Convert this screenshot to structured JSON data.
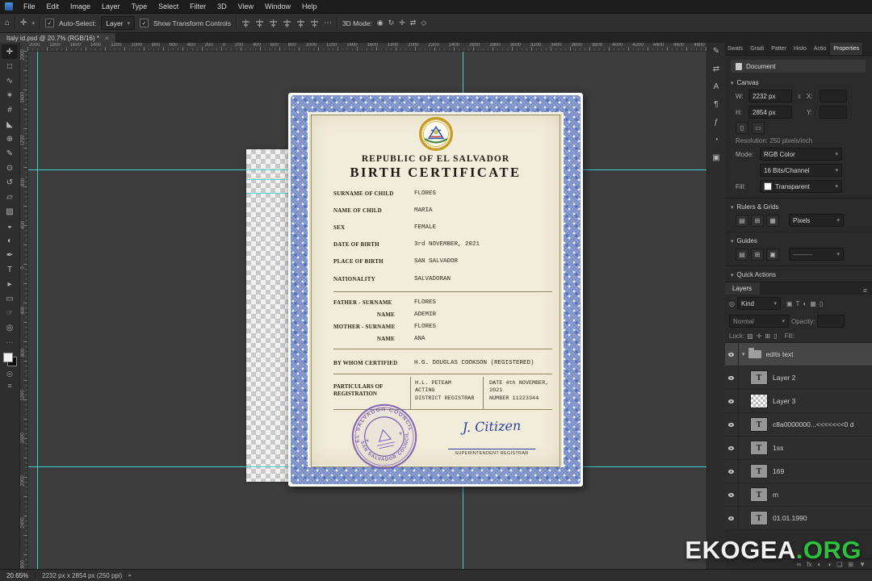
{
  "menu": {
    "items": [
      "File",
      "Edit",
      "Image",
      "Layer",
      "Type",
      "Select",
      "Filter",
      "3D",
      "View",
      "Window",
      "Help"
    ]
  },
  "icons": {
    "home": "⌂",
    "move_tool": "✛",
    "dropdown": "▾",
    "check": "✓",
    "ellipsis": "⋯",
    "menu": "≡",
    "tab_close": "×",
    "star": "✶",
    "link": "∞",
    "search": "◎",
    "scroll_arrow": "▸"
  },
  "options_bar": {
    "auto_select_label": "Auto-Select:",
    "auto_select_value": "Layer",
    "show_transform_label": "Show Transform Controls",
    "mode_3d_label": "3D Mode:",
    "mode_3d_icons": [
      {
        "name": "3d-orbit-icon",
        "glyph": "◉"
      },
      {
        "name": "3d-roll-icon",
        "glyph": "↻"
      },
      {
        "name": "3d-pan-icon",
        "glyph": "✛"
      },
      {
        "name": "3d-slide-icon",
        "glyph": "⇄"
      },
      {
        "name": "3d-scale-icon",
        "glyph": "◇"
      }
    ]
  },
  "document_tab": {
    "title": "Italy id.psd @ 20.7% (RGB/16) *"
  },
  "tools": [
    {
      "name": "move-tool",
      "glyph": "✛"
    },
    {
      "name": "marquee-tool",
      "glyph": "□"
    },
    {
      "name": "lasso-tool",
      "glyph": "∿"
    },
    {
      "name": "magic-wand-tool",
      "glyph": "✶"
    },
    {
      "name": "crop-tool",
      "glyph": "#"
    },
    {
      "name": "eyedropper-tool",
      "glyph": "◣"
    },
    {
      "name": "healing-brush-tool",
      "glyph": "⊕"
    },
    {
      "name": "brush-tool",
      "glyph": "✎"
    },
    {
      "name": "clone-stamp-tool",
      "glyph": "⊙"
    },
    {
      "name": "history-brush-tool",
      "glyph": "↺"
    },
    {
      "name": "eraser-tool",
      "glyph": "▱"
    },
    {
      "name": "gradient-tool",
      "glyph": "▨"
    },
    {
      "name": "blur-tool",
      "glyph": "◒"
    },
    {
      "name": "dodge-tool",
      "glyph": "◐"
    },
    {
      "name": "pen-tool",
      "glyph": "✒"
    },
    {
      "name": "type-tool",
      "glyph": "T"
    },
    {
      "name": "path-select-tool",
      "glyph": "▸"
    },
    {
      "name": "shape-tool",
      "glyph": "▭"
    },
    {
      "name": "hand-tool",
      "glyph": "☞"
    },
    {
      "name": "zoom-tool",
      "glyph": "◎"
    }
  ],
  "ruler": {
    "labels": [
      "2000",
      "1800",
      "1600",
      "1400",
      "1200",
      "1000",
      "800",
      "600",
      "400",
      "200",
      "0",
      "200",
      "400",
      "600",
      "800",
      "1000",
      "1200",
      "1400",
      "1600",
      "1800",
      "2000",
      "2200",
      "2400",
      "2600",
      "2800",
      "3000",
      "3200",
      "3400",
      "3600",
      "3800",
      "4000",
      "4200",
      "4400",
      "4600",
      "4800"
    ],
    "vlabels": [
      "2000",
      "1600",
      "1200",
      "800",
      "400",
      "0",
      "400",
      "800",
      "1200",
      "1600",
      "2000",
      "2400",
      "2800"
    ]
  },
  "certificate": {
    "title1": "REPUBLIC OF EL SALVADOR",
    "title2": "BIRTH CERTIFICATE",
    "fields_main": [
      {
        "label": "SURNAME OF CHILD",
        "value": "FLORES",
        "cls": ""
      },
      {
        "label": "NAME OF CHILD",
        "value": "MARIA",
        "cls": ""
      },
      {
        "label": "SEX",
        "value": "FEMALE",
        "cls": ""
      },
      {
        "label": "DATE OF BIRTH",
        "value": "3rd NOVEMBER, 2021",
        "cls": ""
      },
      {
        "label": "PLACE OF BIRTH",
        "value": "SAN SALVADOR",
        "cls": ""
      },
      {
        "label": "NATIONALITY",
        "value": "SALVADORAN",
        "cls": ""
      }
    ],
    "fields_parents": [
      {
        "label": "FATHER - SURNAME",
        "value": "FLORES",
        "cls": ""
      },
      {
        "label": "NAME",
        "value": "ADEMIR",
        "cls": "sub"
      },
      {
        "label": "MOTHER - SURNAME",
        "value": "FLORES",
        "cls": ""
      },
      {
        "label": "NAME",
        "value": "ANA",
        "cls": "sub"
      }
    ],
    "certified": {
      "label": "BY WHOM CERTIFIED",
      "value": "H.G. DOUGLAS COOKSON (REGISTERED)"
    },
    "particulars": {
      "label_line1": "PARTICULARS OF",
      "label_line2": "REGISTRATION",
      "left_lines": [
        "H.L. PETEAM",
        "ACTING",
        "DISTRICT REGISTRAR"
      ],
      "right_lines": [
        "DATE 4th NOVEMBER,",
        "2021",
        "NUMBER 11223344"
      ]
    },
    "stamp": {
      "top_text": "EL SALVADOR COUNCIL",
      "bottom_text": "· SAN SALVADOR COUNCIL ·"
    },
    "signature": {
      "name": "J. Citizen",
      "title": "SUPERINTENDENT REGISTRAR"
    }
  },
  "right_strip": [
    {
      "name": "brush-settings-panel-icon",
      "glyph": "✎"
    },
    {
      "name": "clone-source-panel-icon",
      "glyph": "⇄"
    },
    {
      "name": "character-panel-icon",
      "glyph": "A"
    },
    {
      "name": "paragraph-panel-icon",
      "glyph": "¶"
    },
    {
      "name": "glyphs-panel-icon",
      "glyph": "ƒ"
    },
    {
      "name": "history-panel-icon",
      "glyph": "◔"
    },
    {
      "name": "libraries-panel-icon",
      "glyph": "▣"
    }
  ],
  "properties": {
    "tabs": [
      {
        "label": "Swats",
        "cls": ""
      },
      {
        "label": "Gradi",
        "cls": ""
      },
      {
        "label": "Patter",
        "cls": ""
      },
      {
        "label": "Histo",
        "cls": ""
      },
      {
        "label": "Actio",
        "cls": ""
      },
      {
        "label": "Properties",
        "cls": "active"
      }
    ],
    "document_label": "Document",
    "canvas": {
      "title": "Canvas",
      "w_label": "W:",
      "w_value": "2232 px",
      "x_label": "X:",
      "h_label": "H:",
      "h_value": "2854 px",
      "y_label": "Y:",
      "resolution": "Resolution: 250 pixels/inch",
      "mode_label": "Mode:",
      "mode_value": "RGB Color",
      "depth_value": "16 Bits/Channel",
      "fill_label": "Fill:",
      "fill_value": "Transparent",
      "orientation_icons": [
        {
          "name": "portrait-icon",
          "glyph": "▯"
        },
        {
          "name": "landscape-icon",
          "glyph": "▭"
        }
      ]
    },
    "rulers_grids": {
      "title": "Rulers & Grids",
      "units_value": "Pixels",
      "icons": [
        {
          "name": "ruler-toggle-icon",
          "glyph": "▤"
        },
        {
          "name": "grid-toggle-icon",
          "glyph": "⊞"
        },
        {
          "name": "snap-toggle-icon",
          "glyph": "▦"
        }
      ]
    },
    "guides": {
      "title": "Guides",
      "line_value": "———",
      "icons": [
        {
          "name": "new-guide-icon",
          "glyph": "▤"
        },
        {
          "name": "guide-layout-icon",
          "glyph": "⊞"
        },
        {
          "name": "clear-guides-icon",
          "glyph": "▣"
        }
      ]
    },
    "quick_actions": {
      "title": "Quick Actions"
    }
  },
  "layers": {
    "title": "Layers",
    "kind_value": "Kind",
    "filter_icons": [
      {
        "name": "filter-pixel-icon",
        "glyph": "▣"
      },
      {
        "name": "filter-type-icon",
        "glyph": "T"
      },
      {
        "name": "filter-adjustment-icon",
        "glyph": "◐"
      },
      {
        "name": "filter-shape-icon",
        "glyph": "▦"
      },
      {
        "name": "filter-smart-object-icon",
        "glyph": "▯"
      }
    ],
    "blend_value": "Normal",
    "opacity_label": "Opacity:",
    "lock_label": "Lock:",
    "lock_icons": [
      {
        "name": "lock-transparency-icon",
        "glyph": "▨"
      },
      {
        "name": "lock-image-icon",
        "glyph": "✛"
      },
      {
        "name": "lock-position-icon",
        "glyph": "⊞"
      },
      {
        "name": "lock-all-icon",
        "glyph": "▯"
      }
    ],
    "fill_label": "Fill:",
    "items": [
      {
        "type": "folder",
        "name": "edits text"
      },
      {
        "type": "text",
        "name": "Layer 2"
      },
      {
        "type": "checker",
        "name": "Layer 3"
      },
      {
        "type": "text",
        "name": "c8a0000000...<<<<<<<0 d"
      },
      {
        "type": "text",
        "name": "1ss"
      },
      {
        "type": "text",
        "name": "169"
      },
      {
        "type": "text",
        "name": "m"
      },
      {
        "type": "text",
        "name": "01.01.1990"
      }
    ],
    "bottom_icons": [
      {
        "name": "link-layers-icon",
        "glyph": "∞"
      },
      {
        "name": "layer-style-icon",
        "glyph": "fx"
      },
      {
        "name": "layer-mask-icon",
        "glyph": "◐"
      },
      {
        "name": "adjustment-layer-icon",
        "glyph": "◑"
      },
      {
        "name": "new-group-icon",
        "glyph": "❏"
      },
      {
        "name": "new-layer-icon",
        "glyph": "⊞"
      },
      {
        "name": "delete-layer-icon",
        "glyph": "▼"
      }
    ]
  },
  "status_bar": {
    "zoom": "20.65%",
    "doc_info": "2232 px x 2854 px (250 ppi)"
  },
  "watermark": {
    "brand": "EKOGEA",
    "suffix": ".ORG"
  },
  "colors": {
    "guide": "#3fd9d9",
    "lace_blue": "#93a6d6",
    "stamp_purple": "#7a5ab0",
    "signature_blue": "#2c3fa3",
    "watermark_green": "#2fbf3f"
  }
}
